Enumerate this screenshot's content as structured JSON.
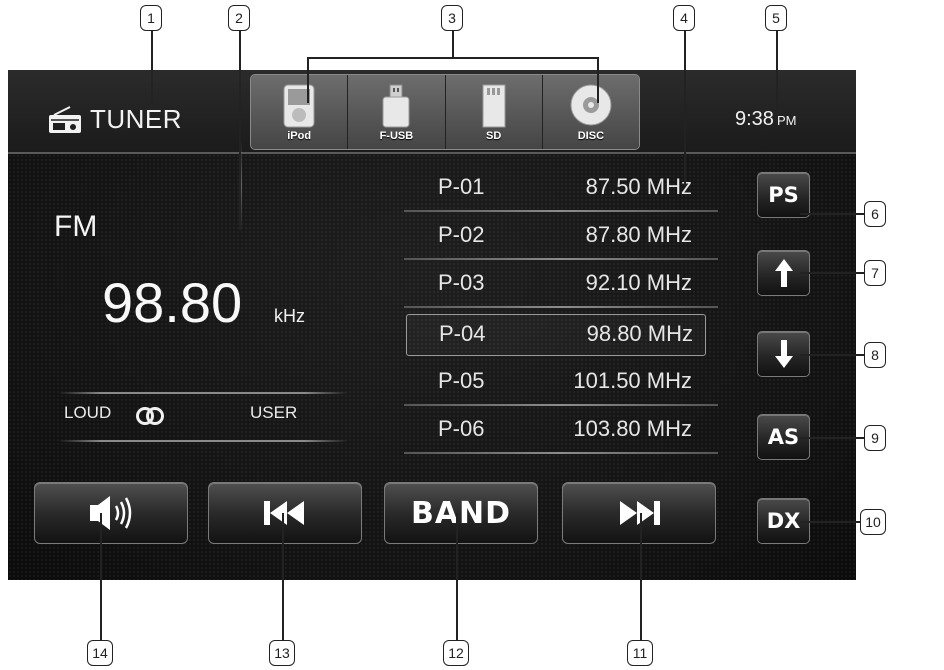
{
  "callouts": [
    "1",
    "2",
    "3",
    "4",
    "5",
    "6",
    "7",
    "8",
    "9",
    "10",
    "11",
    "12",
    "13",
    "14"
  ],
  "header": {
    "title": "TUNER",
    "sources": [
      "iPod",
      "F-USB",
      "SD",
      "DISC"
    ],
    "clock": "9:38",
    "clock_suffix": "PM"
  },
  "tuner": {
    "band": "FM",
    "frequency": "98.80",
    "unit": "kHz",
    "loud_label": "LOUD",
    "user_label": "USER"
  },
  "presets": [
    {
      "name": "P-01",
      "freq": "87.50 MHz",
      "active": false
    },
    {
      "name": "P-02",
      "freq": "87.80 MHz",
      "active": false
    },
    {
      "name": "P-03",
      "freq": "92.10 MHz",
      "active": false
    },
    {
      "name": "P-04",
      "freq": "98.80 MHz",
      "active": true
    },
    {
      "name": "P-05",
      "freq": "101.50 MHz",
      "active": false
    },
    {
      "name": "P-06",
      "freq": "103.80 MHz",
      "active": false
    }
  ],
  "side_buttons": {
    "ps": "PS",
    "up_icon": "arrow-up-icon",
    "down_icon": "arrow-down-icon",
    "as": "AS",
    "dx": "DX"
  },
  "bottom_buttons": {
    "volume_icon": "speaker-icon",
    "prev_icon": "skip-previous-icon",
    "band": "BAND",
    "next_icon": "skip-next-icon"
  },
  "colors": {
    "screen_bg": "#151515",
    "text": "#f2f2f2",
    "button_border": "#7a7a7a"
  }
}
